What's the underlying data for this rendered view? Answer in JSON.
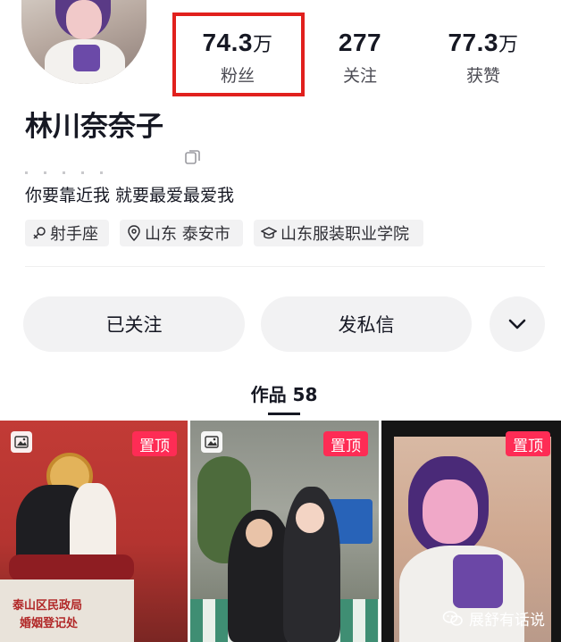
{
  "profile": {
    "name": "林川奈奈子",
    "bio": "你要靠近我 就要最爱最爱我"
  },
  "stats": {
    "fans": {
      "value": "74.3",
      "unit": "万",
      "label": "粉丝"
    },
    "following": {
      "value": "277",
      "unit": "",
      "label": "关注"
    },
    "likes": {
      "value": "77.3",
      "unit": "万",
      "label": "获赞"
    }
  },
  "tags": {
    "zodiac": "射手座",
    "location": "山东 泰安市",
    "school": "山东服装职业学院"
  },
  "actions": {
    "followed_label": "已关注",
    "message_label": "发私信",
    "more_icon": "chevron-down-icon"
  },
  "works": {
    "tab_label": "作品 58",
    "pinned_label": "置顶",
    "thumb1_sign_line1": "泰山区民政局",
    "thumb1_sign_line2": "婚姻登记处"
  },
  "watermark": {
    "text": "展舒有话说"
  },
  "colors": {
    "highlight": "#e1201d",
    "pinned_badge": "#fe2c55",
    "button_bg": "#f2f2f3"
  }
}
